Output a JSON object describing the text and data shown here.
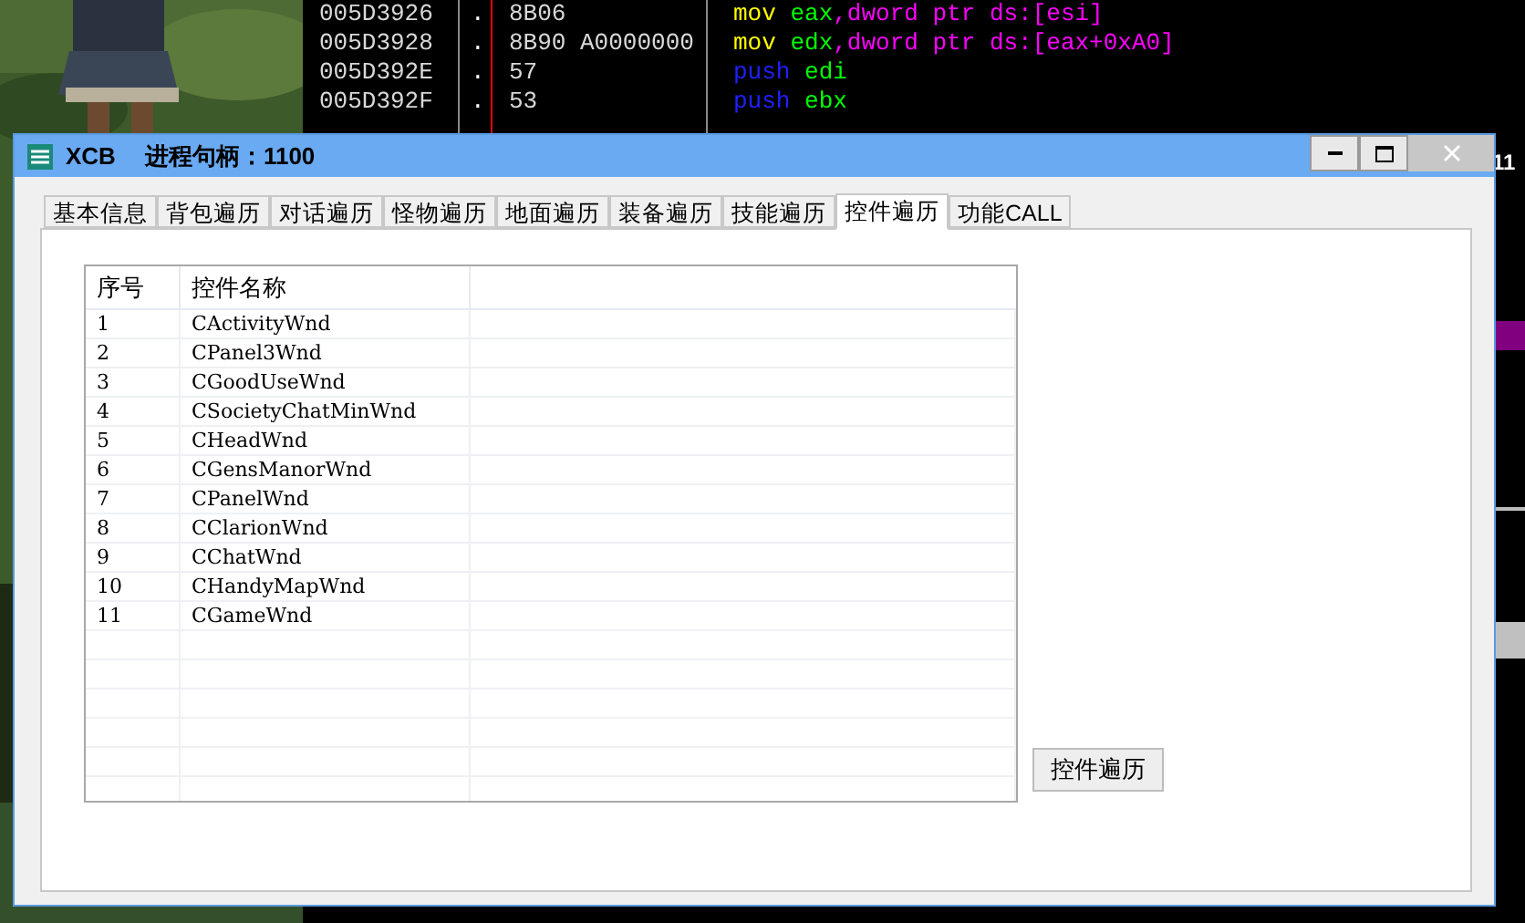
{
  "debugger": {
    "rows": [
      {
        "address": "005D3926",
        "mark": ".",
        "bytes": "8B06",
        "code": [
          {
            "text": "mov ",
            "color": "#ffff00"
          },
          {
            "text": "eax",
            "color": "#00ff00"
          },
          {
            "text": ",dword ptr ds:[esi]",
            "color": "#ff00ff"
          }
        ]
      },
      {
        "address": "005D3928",
        "mark": ".",
        "bytes": "8B90 A0000000",
        "code": [
          {
            "text": "mov ",
            "color": "#ffff00"
          },
          {
            "text": "edx",
            "color": "#00ff00"
          },
          {
            "text": ",dword ptr ds:[eax+0xA0]",
            "color": "#ff00ff"
          }
        ]
      },
      {
        "address": "005D392E",
        "mark": ".",
        "bytes": "57",
        "code": [
          {
            "text": "push ",
            "color": "#2020ff"
          },
          {
            "text": "edi",
            "color": "#00ff00"
          }
        ]
      },
      {
        "address": "005D392F",
        "mark": ".",
        "bytes": "53",
        "code": [
          {
            "text": "push ",
            "color": "#2020ff"
          },
          {
            "text": "ebx",
            "color": "#00ff00"
          }
        ]
      }
    ],
    "side_text": "11"
  },
  "window": {
    "title": "XCB",
    "subtitle": "进程句柄：1100",
    "tabs": [
      {
        "label": "基本信息",
        "selected": false
      },
      {
        "label": "背包遍历",
        "selected": false
      },
      {
        "label": "对话遍历",
        "selected": false
      },
      {
        "label": "怪物遍历",
        "selected": false
      },
      {
        "label": "地面遍历",
        "selected": false
      },
      {
        "label": "装备遍历",
        "selected": false
      },
      {
        "label": "技能遍历",
        "selected": false
      },
      {
        "label": "控件遍历",
        "selected": true
      },
      {
        "label": "功能CALL",
        "selected": false
      }
    ],
    "table": {
      "columns": [
        "序号",
        "控件名称"
      ],
      "rows": [
        [
          "1",
          "CActivityWnd"
        ],
        [
          "2",
          "CPanel3Wnd"
        ],
        [
          "3",
          "CGoodUseWnd"
        ],
        [
          "4",
          "CSocietyChatMinWnd"
        ],
        [
          "5",
          "CHeadWnd"
        ],
        [
          "6",
          "CGensManorWnd"
        ],
        [
          "7",
          "CPanelWnd"
        ],
        [
          "8",
          "CClarionWnd"
        ],
        [
          "9",
          "CChatWnd"
        ],
        [
          "10",
          "CHandyMapWnd"
        ],
        [
          "11",
          "CGameWnd"
        ]
      ]
    },
    "button": "控件遍历"
  }
}
